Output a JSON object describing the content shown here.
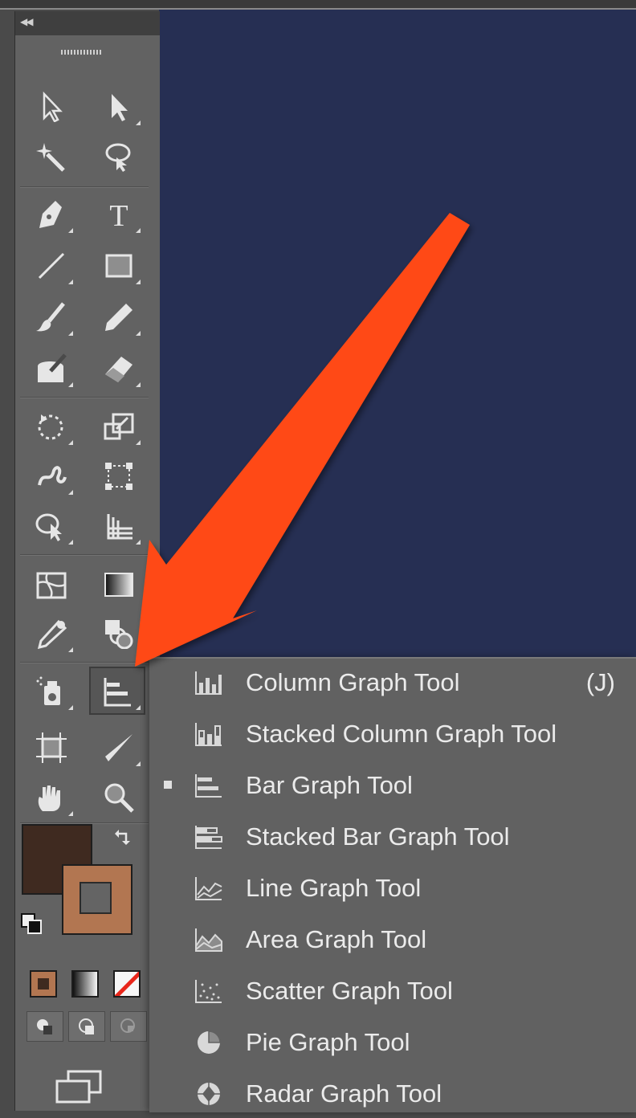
{
  "icons": {
    "collapse": "double-chevron-left-icon",
    "grip": "grip-icon"
  },
  "toolbar": {
    "tools": [
      "selection-tool",
      "direct-selection-tool",
      "magic-wand-tool",
      "lasso-tool",
      "pen-tool",
      "type-tool",
      "line-segment-tool",
      "rectangle-tool",
      "paintbrush-tool",
      "pencil-tool",
      "blob-brush-tool",
      "eraser-tool",
      "rotate-tool",
      "scale-tool",
      "warp-tool",
      "free-transform-tool",
      "shape-builder-tool",
      "perspective-grid-tool",
      "mesh-tool",
      "gradient-tool",
      "eyedropper-tool",
      "blend-tool",
      "symbol-sprayer-tool",
      "bar-graph-tool",
      "artboard-tool",
      "slice-tool",
      "hand-tool",
      "zoom-tool"
    ],
    "type_glyph": "T",
    "active_tool": "bar-graph-tool"
  },
  "colors": {
    "fill": "#3f2a20",
    "stroke": "#b27651",
    "canvas": "#262f53",
    "arrow": "#ff4a12"
  },
  "flyout": {
    "items": [
      {
        "label": "Column Graph Tool",
        "shortcut": "(J)",
        "icon": "column-graph-icon"
      },
      {
        "label": "Stacked Column Graph Tool",
        "icon": "stacked-column-graph-icon"
      },
      {
        "label": "Bar Graph Tool",
        "icon": "bar-graph-icon",
        "current": true
      },
      {
        "label": "Stacked Bar Graph Tool",
        "icon": "stacked-bar-graph-icon"
      },
      {
        "label": "Line Graph Tool",
        "icon": "line-graph-icon"
      },
      {
        "label": "Area Graph Tool",
        "icon": "area-graph-icon"
      },
      {
        "label": "Scatter Graph Tool",
        "icon": "scatter-graph-icon"
      },
      {
        "label": "Pie Graph Tool",
        "icon": "pie-graph-icon"
      },
      {
        "label": "Radar Graph Tool",
        "icon": "radar-graph-icon"
      }
    ]
  }
}
